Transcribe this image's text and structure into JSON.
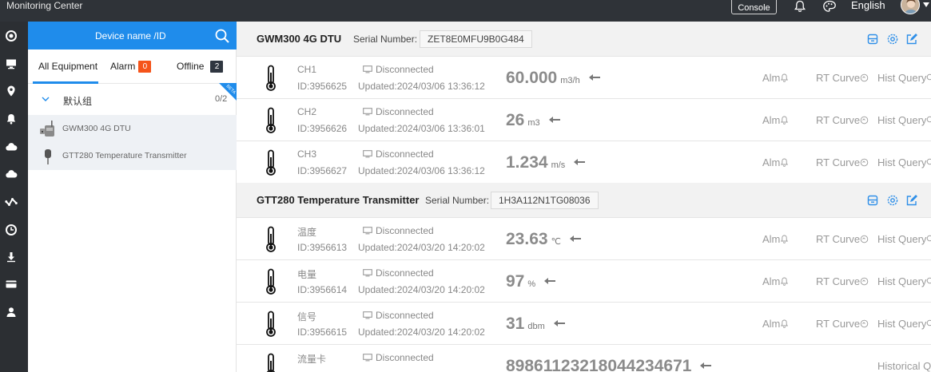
{
  "topbar": {
    "title": "Monitoring Center",
    "console_label": "Console",
    "language": "English"
  },
  "rail_icons": [
    "target-icon",
    "monitor-icon",
    "location-icon",
    "bell-icon",
    "cloud-icon",
    "cloud-icon",
    "network-icon",
    "clock-icon",
    "download-icon",
    "card-icon",
    "user-icon"
  ],
  "device_panel": {
    "header_label": "Device name /ID",
    "tabs": {
      "all": "All Equipment",
      "alarm": "Alarm",
      "alarm_count": "0",
      "offline": "Offline",
      "offline_count": "2"
    },
    "group": {
      "name": "默认组",
      "count": "0/2",
      "corner_tag": "BETA"
    },
    "devices": [
      {
        "name": "GWM300 4G DTU"
      },
      {
        "name": "GTT280 Temperature Transmitter"
      }
    ]
  },
  "main": {
    "serial_label": "Serial Number:",
    "sections": [
      {
        "name": "GWM300 4G DTU",
        "serial": "ZET8E0MFU9B0G484",
        "rows": [
          {
            "ch": "CH1",
            "id": "ID:3956625",
            "status": "Disconnected",
            "updated": "Updated:2024/03/06 13:36:12",
            "value": "60.000",
            "unit": "m3/h",
            "alm": "Alm",
            "rt": "RT Curve",
            "hq": "Hist Query"
          },
          {
            "ch": "CH2",
            "id": "ID:3956626",
            "status": "Disconnected",
            "updated": "Updated:2024/03/06 13:36:01",
            "value": "26",
            "unit": "m3",
            "alm": "Alm",
            "rt": "RT Curve",
            "hq": "Hist Query"
          },
          {
            "ch": "CH3",
            "id": "ID:3956627",
            "status": "Disconnected",
            "updated": "Updated:2024/03/06 13:36:12",
            "value": "1.234",
            "unit": "m/s",
            "alm": "Alm",
            "rt": "RT Curve",
            "hq": "Hist Query"
          }
        ]
      },
      {
        "name": "GTT280 Temperature Transmitter",
        "serial": "1H3A112N1TG08036",
        "rows": [
          {
            "ch": "温度",
            "id": "ID:3956613",
            "status": "Disconnected",
            "updated": "Updated:2024/03/20 14:20:02",
            "value": "23.63",
            "unit": "℃",
            "alm": "Alm",
            "rt": "RT Curve",
            "hq": "Hist Query"
          },
          {
            "ch": "电量",
            "id": "ID:3956614",
            "status": "Disconnected",
            "updated": "Updated:2024/03/20 14:20:02",
            "value": "97",
            "unit": "%",
            "alm": "Alm",
            "rt": "RT Curve",
            "hq": "Hist Query"
          },
          {
            "ch": "信号",
            "id": "ID:3956615",
            "status": "Disconnected",
            "updated": "Updated:2024/03/20 14:20:02",
            "value": "31",
            "unit": "dbm",
            "alm": "Alm",
            "rt": "RT Curve",
            "hq": "Hist Query"
          },
          {
            "ch": "流量卡",
            "id": "",
            "status": "Disconnected",
            "updated": "",
            "value": "89861123218044234671",
            "unit": "",
            "alm": "",
            "rt": "",
            "hq": "Historical Q"
          }
        ]
      }
    ]
  },
  "colors": {
    "topbar": "#2f3338",
    "rail": "#2c2f33",
    "accent": "#1f8ceb",
    "alarm_badge": "#f5541a",
    "offline_badge": "#2f3640",
    "section_icon": "#2f8fe8"
  }
}
